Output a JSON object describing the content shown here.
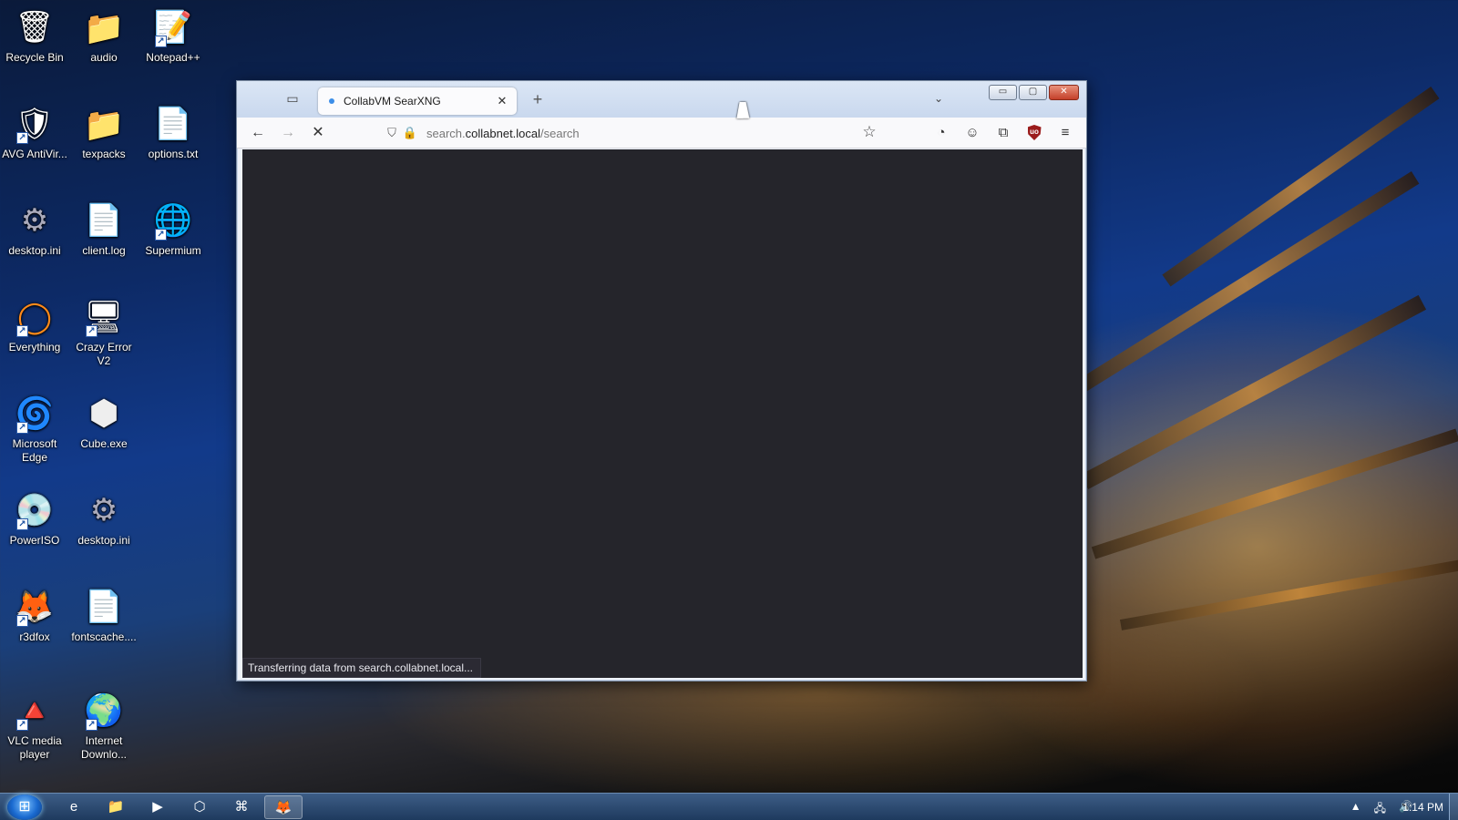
{
  "desktop": {
    "icons": [
      {
        "label": "Recycle Bin",
        "glyph": "🗑"
      },
      {
        "label": "audio",
        "glyph": "📁"
      },
      {
        "label": "Notepad++",
        "glyph": "📝"
      },
      {
        "label": "AVG AntiVir...",
        "glyph": "🛡"
      },
      {
        "label": "texpacks",
        "glyph": "📁"
      },
      {
        "label": "options.txt",
        "glyph": "📄"
      },
      {
        "label": "desktop.ini",
        "glyph": "⚙"
      },
      {
        "label": "client.log",
        "glyph": "📄"
      },
      {
        "label": "Supermium",
        "glyph": "🌐"
      },
      {
        "label": "Everything",
        "glyph": "◯"
      },
      {
        "label": "Crazy Error V2",
        "glyph": "🖥"
      },
      {
        "label": "Microsoft Edge",
        "glyph": "🌀"
      },
      {
        "label": "Cube.exe",
        "glyph": "⬢"
      },
      {
        "label": "PowerISO",
        "glyph": "💿"
      },
      {
        "label": "desktop.ini",
        "glyph": "⚙"
      },
      {
        "label": "r3dfox",
        "glyph": "🦊"
      },
      {
        "label": "fontscache....",
        "glyph": "📄"
      },
      {
        "label": "VLC media player",
        "glyph": "🔺"
      },
      {
        "label": "Internet Downlo...",
        "glyph": "🌍"
      }
    ]
  },
  "browser": {
    "tab": {
      "title": "CollabVM SearXNG",
      "close_glyph": "✕"
    },
    "new_tab_glyph": "+",
    "tab_overflow_glyph": "⌄",
    "window_controls": {
      "minimize": "▭",
      "maximize": "▢",
      "close": "✕"
    },
    "nav": {
      "back": "←",
      "forward": "→",
      "stop": "✕"
    },
    "url": {
      "host": "collabnet.local",
      "prefix": "search.",
      "path": "/search"
    },
    "status": "Transferring data from search.collabnet.local..."
  },
  "taskbar": {
    "clock": "1:14 PM",
    "items": [
      {
        "name": "ie",
        "glyph": "e"
      },
      {
        "name": "explorer",
        "glyph": "📁"
      },
      {
        "name": "media",
        "glyph": "▶"
      },
      {
        "name": "cube",
        "glyph": "⬡"
      },
      {
        "name": "app",
        "glyph": "⌘"
      },
      {
        "name": "r3dfox",
        "glyph": "🦊"
      }
    ]
  }
}
